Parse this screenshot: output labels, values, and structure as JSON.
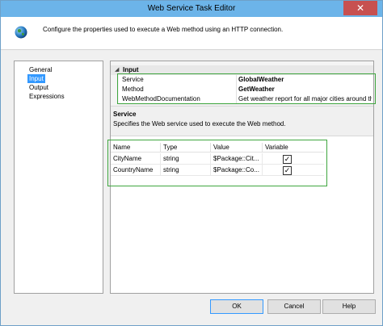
{
  "window": {
    "title": "Web Service Task Editor",
    "close_glyph": "✕"
  },
  "header": {
    "icon": "globe-icon",
    "text": "Configure the properties used to execute a Web method using an HTTP connection."
  },
  "nav": {
    "items": [
      {
        "label": "General",
        "selected": false
      },
      {
        "label": "Input",
        "selected": true
      },
      {
        "label": "Output",
        "selected": false
      },
      {
        "label": "Expressions",
        "selected": false
      }
    ]
  },
  "properties": {
    "category_toggle": "◢",
    "category": "Input",
    "rows": [
      {
        "name": "Service",
        "value": "GlobalWeather"
      },
      {
        "name": "Method",
        "value": "GetWeather"
      },
      {
        "name": "WebMethodDocumentation",
        "value": "Get weather report for all major cities around the w"
      }
    ]
  },
  "description": {
    "title": "Service",
    "text": "Specifies the Web service used to execute the Web method."
  },
  "parameters": {
    "columns": [
      "Name",
      "Type",
      "Value",
      "Variable"
    ],
    "rows": [
      {
        "name": "CityName",
        "type": "string",
        "value": "$Package::Cit...",
        "variable": true
      },
      {
        "name": "CountryName",
        "type": "string",
        "value": "$Package::Co...",
        "variable": true
      }
    ]
  },
  "buttons": {
    "ok": "OK",
    "cancel": "Cancel",
    "help": "Help"
  },
  "colors": {
    "titlebar": "#6cb4e9",
    "close_button": "#c75050",
    "selection": "#3399ff",
    "highlight_box": "#3fa63f"
  }
}
